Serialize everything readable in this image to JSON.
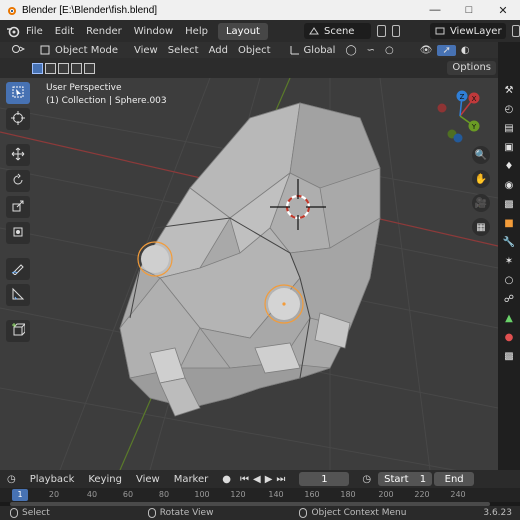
{
  "window": {
    "title": "Blender [E:\\Blender\\fish.blend]",
    "controls": [
      "minimize-icon",
      "maximize-icon",
      "close-icon"
    ]
  },
  "topbar": {
    "menus": [
      "File",
      "Edit",
      "Render",
      "Window",
      "Help"
    ],
    "workspace_tab": "Layout",
    "scene": "Scene",
    "view_layer": "ViewLayer"
  },
  "viewport_header": {
    "mode": "Object Mode",
    "menus": [
      "View",
      "Select",
      "Add",
      "Object"
    ],
    "transform_orientation": "Global"
  },
  "tool_settings": {
    "options_label": "Options"
  },
  "viewport": {
    "view_name": "User Perspective",
    "collection_info": "(1) Collection | Sphere.003",
    "axes": {
      "x": "X",
      "y": "Y",
      "z": "Z"
    },
    "colors": {
      "background": "#3d3d3d",
      "mesh": "#a8a8a8",
      "selection": "#f39c3a",
      "x_axis": "#c0393b",
      "y_axis": "#6a9a24",
      "z_axis": "#2f7fd8"
    }
  },
  "timeline": {
    "menus": [
      "Playback",
      "Keying",
      "View",
      "Marker"
    ],
    "current_frame": "1",
    "start_label": "Start",
    "start_value": "1",
    "end_label": "End",
    "ruler_ticks": [
      "20",
      "40",
      "60",
      "80",
      "100",
      "120",
      "140",
      "160",
      "180",
      "200",
      "220",
      "240"
    ],
    "ruler_current": "1"
  },
  "statusbar": {
    "select": "Select",
    "rotate_view": "Rotate View",
    "context_menu": "Object Context Menu",
    "version": "3.6.23"
  }
}
